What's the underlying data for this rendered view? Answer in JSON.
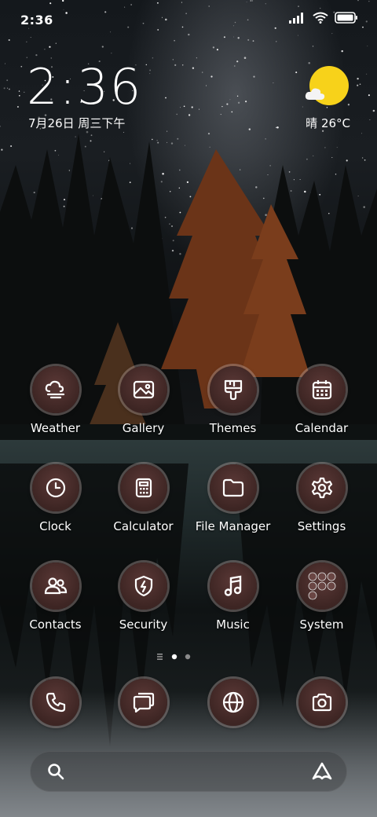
{
  "status_bar": {
    "time": "2:36"
  },
  "clock_widget": {
    "time": "2:36",
    "date": "7月26日 周三下午"
  },
  "weather_widget": {
    "condition": "晴",
    "temperature": "26°C"
  },
  "apps": {
    "row1": [
      {
        "label": "Weather",
        "icon": "weather-icon"
      },
      {
        "label": "Gallery",
        "icon": "gallery-icon"
      },
      {
        "label": "Themes",
        "icon": "themes-icon"
      },
      {
        "label": "Calendar",
        "icon": "calendar-icon"
      }
    ],
    "row2": [
      {
        "label": "Clock",
        "icon": "clock-icon"
      },
      {
        "label": "Calculator",
        "icon": "calculator-icon"
      },
      {
        "label": "File Manager",
        "icon": "folder-icon"
      },
      {
        "label": "Settings",
        "icon": "gear-icon"
      }
    ],
    "row3": [
      {
        "label": "Contacts",
        "icon": "contacts-icon"
      },
      {
        "label": "Security",
        "icon": "shield-icon"
      },
      {
        "label": "Music",
        "icon": "music-icon"
      },
      {
        "label": "System",
        "icon": "folder-grid-icon"
      }
    ]
  },
  "dock": [
    {
      "icon": "phone-icon"
    },
    {
      "icon": "messages-icon"
    },
    {
      "icon": "browser-icon"
    },
    {
      "icon": "camera-icon"
    }
  ],
  "pager": {
    "pages": 2,
    "current": 1
  },
  "colors": {
    "icon_bg": "#3d2523",
    "sun": "#f7d21a"
  }
}
